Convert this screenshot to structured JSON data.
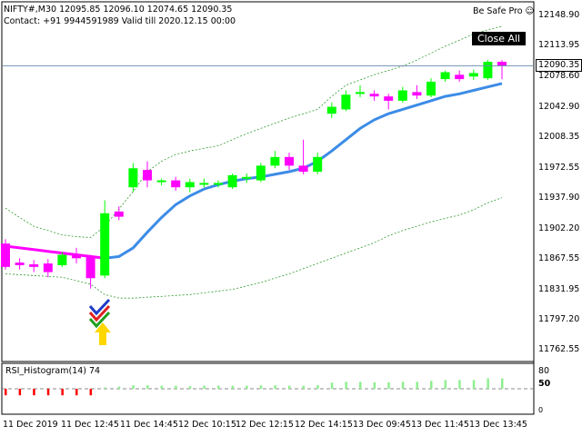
{
  "header": {
    "symbol_line": "NIFTY#,M30  12095.85 12096.10 12074.65 12090.35",
    "contact_line": "Contact: +91 9944591989 Valid till 2020.12.15 00:00",
    "ea_name": "Be Safe Pro",
    "ea_icon": "smiley-icon"
  },
  "close_all_label": "Close All",
  "current_price": "12090.35",
  "price_axis": [
    "12148.90",
    "12113.95",
    "12078.60",
    "12042.90",
    "12008.35",
    "11972.55",
    "11937.90",
    "11902.20",
    "11867.55",
    "11831.95",
    "11797.20",
    "11762.55"
  ],
  "time_axis": [
    "11 Dec 2019",
    "11 Dec 12:45",
    "11 Dec 14:45",
    "12 Dec 10:15",
    "12 Dec 12:15",
    "12 Dec 14:15",
    "13 Dec 09:45",
    "13 Dec 11:45",
    "13 Dec 13:45"
  ],
  "indicator": {
    "title": "RSI_Histogram(14) 74",
    "axis": [
      "80",
      "50",
      "0"
    ],
    "zero_axis_label": "0.00"
  },
  "colors": {
    "bull": "#00ff00",
    "bear": "#ff00ff",
    "ma": "#3c8ce6",
    "band": "#2e9a2e",
    "grid_line": "#6a8caf",
    "rsi_up": "#90ee90",
    "rsi_down": "#ff0000",
    "arrow": "#ffd700"
  },
  "chart_data": {
    "type": "candlestick",
    "candles": [
      {
        "o": 11885,
        "c": 11858,
        "h": 11890,
        "l": 11855
      },
      {
        "o": 11863,
        "c": 11860,
        "h": 11868,
        "l": 11855
      },
      {
        "o": 11861,
        "c": 11858,
        "h": 11866,
        "l": 11852
      },
      {
        "o": 11862,
        "c": 11852,
        "h": 11867,
        "l": 11846
      },
      {
        "o": 11860,
        "c": 11872,
        "h": 11875,
        "l": 11858
      },
      {
        "o": 11873,
        "c": 11868,
        "h": 11880,
        "l": 11862
      },
      {
        "o": 11869,
        "c": 11845,
        "h": 11872,
        "l": 11833
      },
      {
        "o": 11848,
        "c": 11920,
        "h": 11935,
        "l": 11845
      },
      {
        "o": 11922,
        "c": 11916,
        "h": 11928,
        "l": 11912
      },
      {
        "o": 11950,
        "c": 11972,
        "h": 11978,
        "l": 11945
      },
      {
        "o": 11970,
        "c": 11958,
        "h": 11980,
        "l": 11950
      },
      {
        "o": 11956,
        "c": 11958,
        "h": 11960,
        "l": 11952
      },
      {
        "o": 11958,
        "c": 11950,
        "h": 11962,
        "l": 11946
      },
      {
        "o": 11950,
        "c": 11956,
        "h": 11960,
        "l": 11944
      },
      {
        "o": 11954,
        "c": 11955,
        "h": 11960,
        "l": 11950
      },
      {
        "o": 11955,
        "c": 11955,
        "h": 11958,
        "l": 11950
      },
      {
        "o": 11950,
        "c": 11964,
        "h": 11966,
        "l": 11948
      },
      {
        "o": 11962,
        "c": 11962,
        "h": 11966,
        "l": 11955
      },
      {
        "o": 11958,
        "c": 11975,
        "h": 11978,
        "l": 11956
      },
      {
        "o": 11975,
        "c": 11985,
        "h": 11992,
        "l": 11972
      },
      {
        "o": 11985,
        "c": 11975,
        "h": 11990,
        "l": 11970
      },
      {
        "o": 11975,
        "c": 11968,
        "h": 12005,
        "l": 11965
      },
      {
        "o": 11968,
        "c": 11985,
        "h": 11990,
        "l": 11965
      },
      {
        "o": 12035,
        "c": 12043,
        "h": 12048,
        "l": 12030
      },
      {
        "o": 12040,
        "c": 12057,
        "h": 12062,
        "l": 12038
      },
      {
        "o": 12058,
        "c": 12060,
        "h": 12068,
        "l": 12054
      },
      {
        "o": 12058,
        "c": 12055,
        "h": 12062,
        "l": 12050
      },
      {
        "o": 12055,
        "c": 12050,
        "h": 12058,
        "l": 12040
      },
      {
        "o": 12050,
        "c": 12062,
        "h": 12066,
        "l": 12048
      },
      {
        "o": 12060,
        "c": 12056,
        "h": 12068,
        "l": 12052
      },
      {
        "o": 12056,
        "c": 12072,
        "h": 12076,
        "l": 12054
      },
      {
        "o": 12075,
        "c": 12083,
        "h": 12085,
        "l": 12072
      },
      {
        "o": 12080,
        "c": 12075,
        "h": 12085,
        "l": 12072
      },
      {
        "o": 12078,
        "c": 12082,
        "h": 12086,
        "l": 12074
      },
      {
        "o": 12076,
        "c": 12095,
        "h": 12097,
        "l": 12074
      },
      {
        "o": 12095,
        "c": 12090,
        "h": 12097,
        "l": 12075
      }
    ],
    "ma": [
      11882,
      11880,
      11878,
      11876,
      11874,
      11872,
      11870,
      11868,
      11870,
      11880,
      11898,
      11915,
      11930,
      11940,
      11948,
      11953,
      11957,
      11960,
      11962,
      11965,
      11968,
      11972,
      11980,
      11992,
      12005,
      12018,
      12028,
      12035,
      12040,
      12045,
      12050,
      12055,
      12058,
      12062,
      12066,
      12070
    ],
    "upper_band": [
      11926,
      11915,
      11905,
      11900,
      11895,
      11893,
      11892,
      11905,
      11925,
      11945,
      11968,
      11980,
      11988,
      11992,
      11995,
      11998,
      12005,
      12012,
      12018,
      12024,
      12030,
      12035,
      12040,
      12055,
      12068,
      12074,
      12080,
      12085,
      12090,
      12097,
      12105,
      12113,
      12120,
      12127,
      12132,
      12136
    ],
    "lower_band": [
      11850,
      11849,
      11848,
      11847,
      11846,
      11842,
      11838,
      11826,
      11822,
      11822,
      11823,
      11824,
      11825,
      11826,
      11828,
      11830,
      11832,
      11836,
      11840,
      11845,
      11850,
      11856,
      11862,
      11868,
      11874,
      11880,
      11886,
      11894,
      11900,
      11905,
      11910,
      11914,
      11918,
      11924,
      11932,
      11938
    ],
    "rsi": [
      35,
      35,
      35,
      35,
      35,
      35,
      35,
      53,
      55,
      58,
      58,
      57,
      57,
      56,
      57,
      57,
      57,
      57,
      58,
      58,
      57,
      57,
      58,
      64,
      66,
      66,
      65,
      65,
      66,
      66,
      68,
      70,
      70,
      70,
      74,
      74
    ],
    "ylim": [
      11755,
      12158
    ],
    "rsi_ylim": [
      0,
      100
    ]
  }
}
